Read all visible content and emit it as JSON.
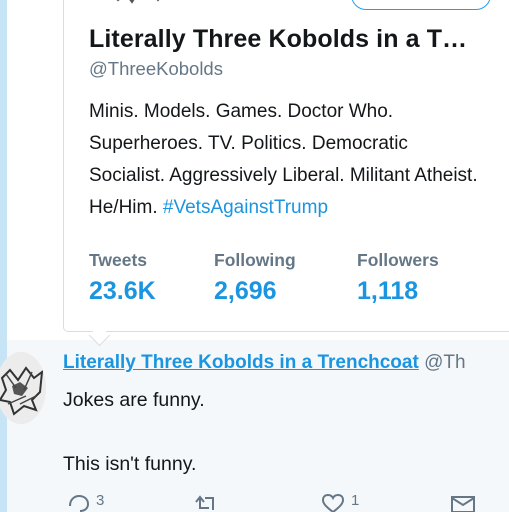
{
  "profile_card": {
    "name": "Literally Three Kobolds in a T…",
    "handle": "@ThreeKobolds",
    "bio_text": "Minis. Models. Games. Doctor Who. Superheroes. TV. Politics. Democratic Socialist. Aggressively Liberal. Militant Atheist. He/Him.",
    "bio_hashtag": "#VetsAgainstTrump",
    "stats": [
      {
        "label": "Tweets",
        "value": "23.6K"
      },
      {
        "label": "Following",
        "value": "2,696"
      },
      {
        "label": "Followers",
        "value": "1,118"
      }
    ]
  },
  "tweet": {
    "author_name": "Literally Three Kobolds in a Trenchcoat",
    "author_handle": "@Th",
    "line1": "Jokes are funny.",
    "line2": "This isn't funny.",
    "actions": {
      "reply_count": "3",
      "like_count": "1"
    }
  },
  "colors": {
    "accent": "#1b95e0",
    "muted": "#657786",
    "text": "#14171a",
    "thread_rule": "#c6e4f5"
  },
  "icons": [
    "reply-icon",
    "retweet-icon",
    "like-icon",
    "message-icon"
  ]
}
